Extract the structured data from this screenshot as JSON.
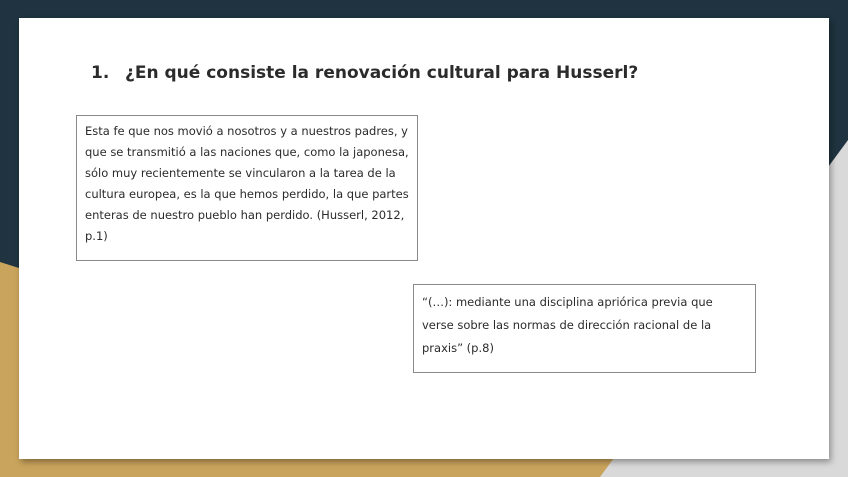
{
  "slide": {
    "heading_number": "1.",
    "heading_text": "¿En qué consiste la renovación cultural para Husserl?",
    "quote_1": "Esta fe que nos movió a nosotros y a nuestros padres, y que se transmitió a las naciones que, como la japonesa, sólo muy recientemente se vincularon a la tarea de la cultura europea, es la que hemos perdido, la que partes enteras de nuestro pueblo han perdido. (Husserl, 2012, p.1)",
    "quote_2": "“(…): mediante una disciplina apriórica previa que verse sobre las normas de dirección racional de la praxis” (p.8)"
  },
  "colors": {
    "background_dark": "#1f3440",
    "accent_gold": "#c9a45c",
    "accent_light": "#d9d9d9",
    "slide_bg": "#ffffff"
  }
}
